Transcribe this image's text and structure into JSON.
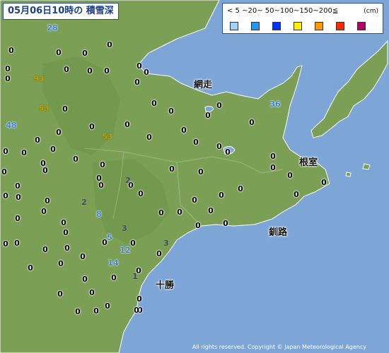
{
  "header": {
    "title": "05月06日10時の 積雪深"
  },
  "legend": {
    "scale": "< 5 ~20~ 50~100~150~200≦",
    "unit": "(cm)",
    "swatches": [
      {
        "color": "#a0d2ff"
      },
      {
        "color": "#2196f3"
      },
      {
        "color": "#0033ff"
      },
      {
        "color": "#ffee00"
      },
      {
        "color": "#ff9900"
      },
      {
        "color": "#ff2800"
      },
      {
        "color": "#b40068"
      }
    ]
  },
  "places": [
    {
      "name": "網走"
    },
    {
      "name": "根室"
    },
    {
      "name": "釧路"
    },
    {
      "name": "十勝"
    }
  ],
  "stations": [
    {
      "v": "28"
    },
    {
      "v": "0"
    },
    {
      "v": "0"
    },
    {
      "v": "0"
    },
    {
      "v": "0"
    },
    {
      "v": "0"
    },
    {
      "v": "0"
    },
    {
      "v": "0"
    },
    {
      "v": "0"
    },
    {
      "v": "93"
    },
    {
      "v": "0"
    },
    {
      "v": "0"
    },
    {
      "v": "0"
    },
    {
      "v": "0"
    },
    {
      "v": "0"
    },
    {
      "v": "0"
    },
    {
      "v": "53"
    },
    {
      "v": "0"
    },
    {
      "v": "0"
    },
    {
      "v": "0"
    },
    {
      "v": "0"
    },
    {
      "v": "0"
    },
    {
      "v": "0"
    },
    {
      "v": "0"
    },
    {
      "v": "36"
    },
    {
      "v": "48"
    },
    {
      "v": "0"
    },
    {
      "v": "0"
    },
    {
      "v": "0"
    },
    {
      "v": "53"
    },
    {
      "v": "0"
    },
    {
      "v": "0"
    },
    {
      "v": "0"
    },
    {
      "v": "0"
    },
    {
      "v": "0"
    },
    {
      "v": "0"
    },
    {
      "v": "0"
    },
    {
      "v": "0"
    },
    {
      "v": "0"
    },
    {
      "v": "0"
    },
    {
      "v": "0"
    },
    {
      "v": "0"
    },
    {
      "v": "0"
    },
    {
      "v": "0"
    },
    {
      "v": "0"
    },
    {
      "v": "0"
    },
    {
      "v": "0"
    },
    {
      "v": "0"
    },
    {
      "v": "0"
    },
    {
      "v": "0"
    },
    {
      "v": "2"
    },
    {
      "v": "0"
    },
    {
      "v": "0"
    },
    {
      "v": "0"
    },
    {
      "v": "0"
    },
    {
      "v": "0"
    },
    {
      "v": "0"
    },
    {
      "v": "0"
    },
    {
      "v": "0"
    },
    {
      "v": "0"
    },
    {
      "v": "0"
    },
    {
      "v": "0"
    },
    {
      "v": "0"
    },
    {
      "v": "0"
    },
    {
      "v": "0"
    },
    {
      "v": "0"
    },
    {
      "v": "0"
    },
    {
      "v": "2"
    },
    {
      "v": "0"
    },
    {
      "v": "0"
    },
    {
      "v": "0"
    },
    {
      "v": "0"
    },
    {
      "v": "0"
    },
    {
      "v": "8"
    },
    {
      "v": "0"
    },
    {
      "v": "0"
    },
    {
      "v": "0"
    },
    {
      "v": "0"
    },
    {
      "v": "3"
    },
    {
      "v": "0"
    },
    {
      "v": "0"
    },
    {
      "v": "0"
    },
    {
      "v": "5"
    },
    {
      "v": "3"
    },
    {
      "v": "0"
    },
    {
      "v": "0"
    },
    {
      "v": "0"
    },
    {
      "v": "12"
    },
    {
      "v": "0"
    },
    {
      "v": "14"
    },
    {
      "v": "0"
    },
    {
      "v": "1"
    },
    {
      "v": "0"
    },
    {
      "v": "0"
    },
    {
      "v": "0"
    },
    {
      "v": "0"
    },
    {
      "v": "0"
    },
    {
      "v": "0"
    }
  ],
  "footer": {
    "copyright": "All rights reserved. Copyright © Japan Meteorological Agency"
  }
}
